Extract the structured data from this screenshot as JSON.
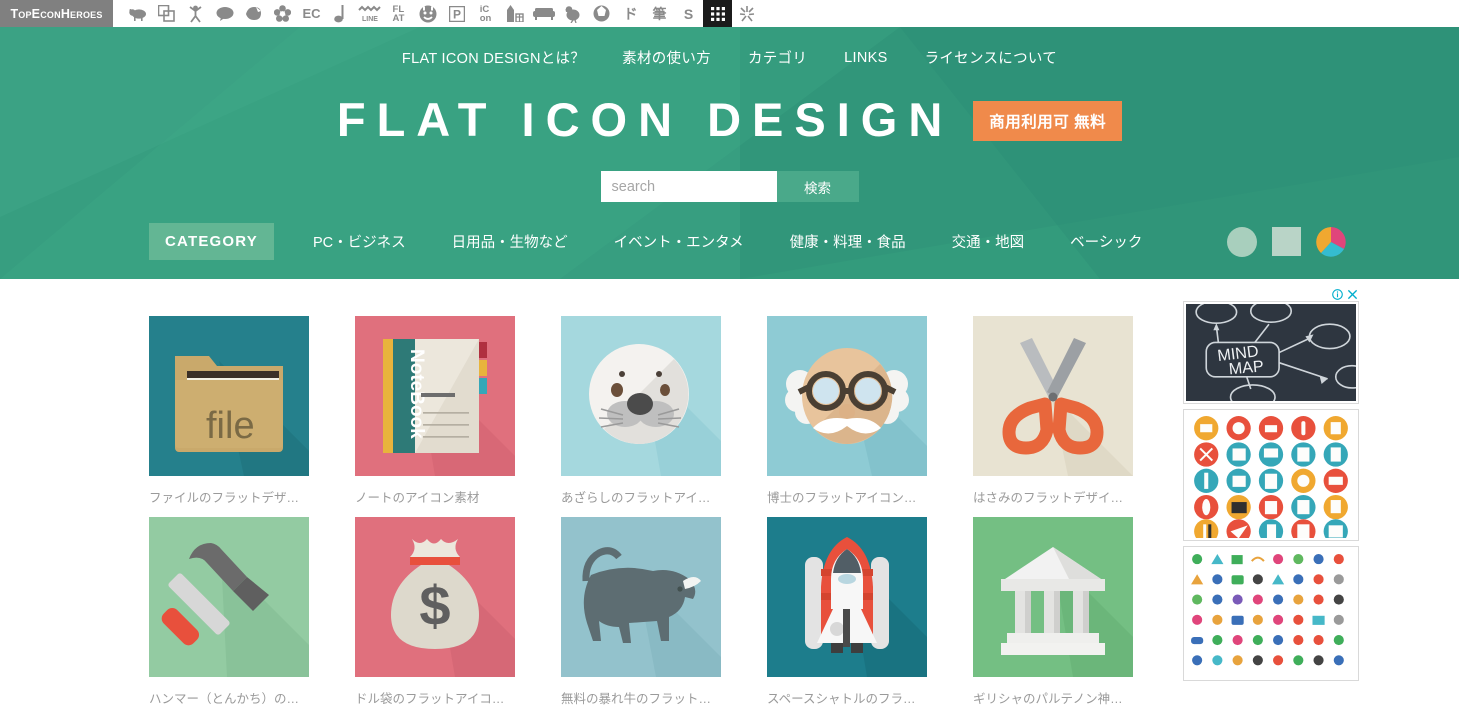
{
  "topbar": {
    "brand": "TopEconHeroes",
    "icons": [
      {
        "name": "sheep-icon",
        "glyph": "sheep"
      },
      {
        "name": "copy-icon",
        "glyph": "copy"
      },
      {
        "name": "person-icon",
        "glyph": "person"
      },
      {
        "name": "speech-bubble-icon",
        "glyph": "bubble"
      },
      {
        "name": "leaf-icon",
        "glyph": "leaf"
      },
      {
        "name": "flower-icon",
        "glyph": "flower"
      },
      {
        "name": "ec-icon",
        "glyph": "text",
        "text": "EC"
      },
      {
        "name": "music-note-icon",
        "glyph": "note"
      },
      {
        "name": "line-icon",
        "glyph": "text",
        "text": "LINE"
      },
      {
        "name": "flat-icon",
        "glyph": "text",
        "text": "FLAT"
      },
      {
        "name": "smiley-icon",
        "glyph": "smiley"
      },
      {
        "name": "parking-icon",
        "glyph": "text",
        "text": "P"
      },
      {
        "name": "icon-icon",
        "glyph": "text",
        "text": "iCon"
      },
      {
        "name": "building-icon",
        "glyph": "building"
      },
      {
        "name": "sofa-icon",
        "glyph": "sofa"
      },
      {
        "name": "bird-icon",
        "glyph": "bird"
      },
      {
        "name": "ball-icon",
        "glyph": "ball"
      },
      {
        "name": "door-icon",
        "glyph": "text",
        "text": "ド"
      },
      {
        "name": "brush-icon",
        "glyph": "text",
        "text": "筆"
      },
      {
        "name": "s-icon",
        "glyph": "text",
        "text": "S"
      },
      {
        "name": "grid-icon",
        "glyph": "grid",
        "dark": true
      },
      {
        "name": "sparkle-icon",
        "glyph": "sparkle"
      }
    ]
  },
  "nav": {
    "items": [
      {
        "label": "FLAT ICON DESIGNとは？",
        "name": "nav-about"
      },
      {
        "label": "素材の使い方",
        "name": "nav-usage"
      },
      {
        "label": "カテゴリ",
        "name": "nav-category"
      },
      {
        "label": "LINKS",
        "name": "nav-links"
      },
      {
        "label": "ライセンスについて",
        "name": "nav-license"
      }
    ]
  },
  "hero": {
    "title": "FLAT ICON DESIGN",
    "badge": "商用利用可 無料",
    "bg_color": "#339b7c",
    "badge_color": "#f08a4b"
  },
  "search": {
    "placeholder": "search",
    "value": "",
    "button_label": "検索"
  },
  "category": {
    "heading": "CATEGORY",
    "items": [
      {
        "label": "PC・ビジネス",
        "name": "cat-pc-business"
      },
      {
        "label": "日用品・生物など",
        "name": "cat-daily-goods"
      },
      {
        "label": "イベント・エンタメ",
        "name": "cat-event-entertainment"
      },
      {
        "label": "健康・料理・食品",
        "name": "cat-health-food"
      },
      {
        "label": "交通・地図",
        "name": "cat-transport-map"
      },
      {
        "label": "ベーシック",
        "name": "cat-basic"
      }
    ],
    "swatches": [
      {
        "name": "swatch-circle",
        "color": "#a8cfbd"
      },
      {
        "name": "swatch-square",
        "color": "#b9d4c7"
      },
      {
        "name": "swatch-color-wheel",
        "colors": [
          "#e0457b",
          "#f0a830",
          "#35bcd0"
        ]
      }
    ]
  },
  "grid": {
    "tiles": [
      {
        "name": "tile-file",
        "caption": "ファイルのフラットデザ…",
        "bg": "#25808c",
        "art": "file",
        "label": "file"
      },
      {
        "name": "tile-notebook",
        "caption": "ノートのアイコン素材",
        "bg": "#e0707d",
        "art": "notebook",
        "label": "NoteBook"
      },
      {
        "name": "tile-seal",
        "caption": "あざらしのフラットアイ…",
        "bg": "#a5d8de",
        "art": "seal"
      },
      {
        "name": "tile-doctor",
        "caption": "博士のフラットアイコン…",
        "bg": "#8ecbd4",
        "art": "doctor"
      },
      {
        "name": "tile-scissors",
        "caption": "はさみのフラットデザイ…",
        "bg": "#e8e3d2",
        "art": "scissors"
      },
      {
        "name": "tile-hammer",
        "caption": "ハンマー（とんかち）の…",
        "bg": "#93cba2",
        "art": "hammer"
      },
      {
        "name": "tile-moneybag",
        "caption": "ドル袋のフラットアイコ…",
        "bg": "#e0707d",
        "art": "moneybag",
        "label": "$"
      },
      {
        "name": "tile-bull",
        "caption": "無料の暴れ牛のフラット…",
        "bg": "#93c2cc",
        "art": "bull"
      },
      {
        "name": "tile-shuttle",
        "caption": "スペースシャトルのフラ…",
        "bg": "#1d7d8c",
        "art": "shuttle"
      },
      {
        "name": "tile-parthenon",
        "caption": "ギリシャのパルテノン神…",
        "bg": "#74bf83",
        "art": "parthenon"
      }
    ]
  },
  "ad": {
    "info_icon": "info-icon",
    "close_icon": "close-icon",
    "photo_text": "MIND MAP",
    "photo_bg": "#2e3640"
  }
}
